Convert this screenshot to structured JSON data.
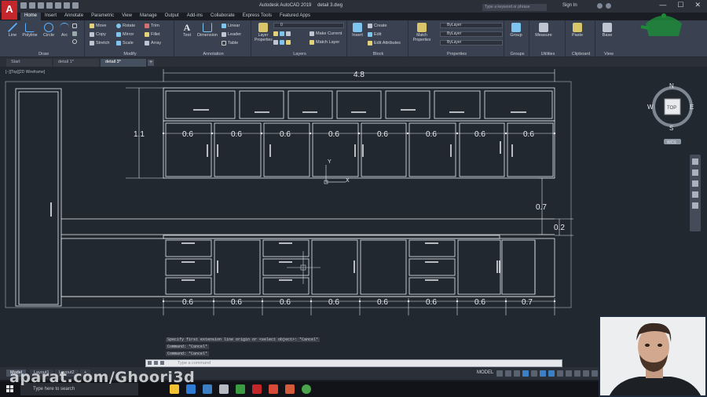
{
  "window": {
    "app_name": "Autodesk AutoCAD 2019",
    "file_name": "detail 3.dwg",
    "search_placeholder": "Type a keyword or phrase",
    "signin_label": "Sign In",
    "min": "—",
    "max": "☐",
    "close": "✕"
  },
  "ribbon_tabs": [
    "Home",
    "Insert",
    "Annotate",
    "Parametric",
    "View",
    "Manage",
    "Output",
    "Add-ins",
    "Collaborate",
    "Express Tools",
    "Featured Apps"
  ],
  "ribbon": {
    "draw": {
      "title": "Draw",
      "line": "Line",
      "polyline": "Polyline",
      "circle": "Circle",
      "arc": "Arc"
    },
    "modify": {
      "title": "Modify",
      "move": "Move",
      "rotate": "Rotate",
      "trim": "Trim",
      "copy": "Copy",
      "mirror": "Mirror",
      "fillet": "Fillet",
      "stretch": "Stretch",
      "scale": "Scale",
      "array": "Array"
    },
    "annotation": {
      "title": "Annotation",
      "text": "Text",
      "dimension": "Dimension",
      "linear": "Linear",
      "leader": "Leader",
      "table": "Table"
    },
    "layers": {
      "title": "Layers",
      "layer_props": "Layer Properties",
      "layer_value": "0",
      "make_current": "Make Current",
      "match_layer": "Match Layer"
    },
    "block": {
      "title": "Block",
      "insert": "Insert",
      "create": "Create",
      "edit": "Edit",
      "edit_attr": "Edit Attributes"
    },
    "properties": {
      "title": "Properties",
      "match": "Match Properties",
      "bylayer1": "ByLayer",
      "bylayer2": "ByLayer",
      "bylayer3": "ByLayer"
    },
    "groups": {
      "title": "Groups",
      "group": "Group"
    },
    "utilities": {
      "title": "Utilities",
      "measure": "Measure"
    },
    "clipboard": {
      "title": "Clipboard",
      "paste": "Paste"
    },
    "view": {
      "title": "View",
      "base": "Base"
    }
  },
  "file_tabs": [
    "Start",
    "detail 1*",
    "detail 3*"
  ],
  "viewport_label": "[−][Top][2D Wireframe]",
  "dimensions": {
    "overall_width": "4.8",
    "height": "1.1",
    "upper_widths": [
      "0.6",
      "0.6",
      "0.6",
      "0.6",
      "0.6",
      "0.6",
      "0.6",
      "0.6"
    ],
    "gap": "0.7",
    "counter": "0.2",
    "lower_widths": [
      "0.6",
      "0.6",
      "0.6",
      "0.6",
      "0.6",
      "0.6",
      "0.6",
      "0.7"
    ]
  },
  "ucs": {
    "y": "Y",
    "x": "X"
  },
  "viewcube": {
    "n": "N",
    "s": "S",
    "e": "E",
    "w": "W",
    "top": "TOP",
    "wcs": "WCS"
  },
  "command": {
    "history": [
      "Specify first extension line origin or <select object>: *Cancel*",
      "Command: *Cancel*",
      "Command: *Cancel*"
    ],
    "placeholder": "Type a command"
  },
  "layout_tabs": [
    "Model",
    "Layout1",
    "Layout2"
  ],
  "status": {
    "model": "MODEL"
  },
  "taskbar": {
    "search": "Type here to search"
  },
  "watermark": "aparat.com/Ghoori3d",
  "colors": {
    "ribbon": "#3a4150",
    "drawing_bg": "#212830",
    "autocad_red": "#c3272b"
  }
}
